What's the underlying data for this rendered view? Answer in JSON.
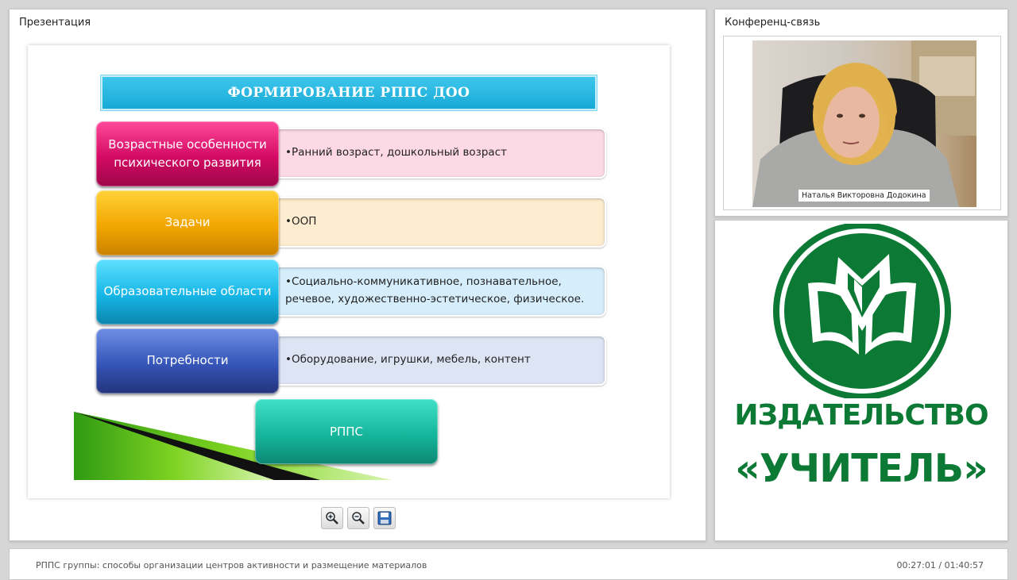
{
  "presentation_panel": {
    "title": "Презентация",
    "slide": {
      "header": "ФОРМИРОВАНИЕ РППС ДОО",
      "rows": [
        {
          "label": "Возрастные особенности психического развития",
          "text": "•Ранний возраст, дошкольный возраст"
        },
        {
          "label": "Задачи",
          "text": "•ООП"
        },
        {
          "label": "Образовательные области",
          "text": "•Социально-коммуникативное, познавательное, речевое, художественно-эстетическое, физическое."
        },
        {
          "label": "Потребности",
          "text": "•Оборудование, игрушки, мебель, контент"
        }
      ],
      "result": "РППС"
    },
    "toolbar": {
      "zoom_in_icon": "zoom-in-icon",
      "zoom_out_icon": "zoom-out-icon",
      "save_icon": "save-icon"
    }
  },
  "conference_panel": {
    "title": "Конференц-связь",
    "speaker_name": "Наталья Викторовна Додокина"
  },
  "logo_panel": {
    "publisher_name": "ИЗДАТЕЛЬСТВО",
    "publisher_title": "«УЧИТЕЛЬ»",
    "brand_color": "#0c7a35"
  },
  "bottom_bar": {
    "lecture_title": "РППС группы: способы организации центров активности и размещение материалов",
    "timecode": "00:27:01 / 01:40:57"
  }
}
